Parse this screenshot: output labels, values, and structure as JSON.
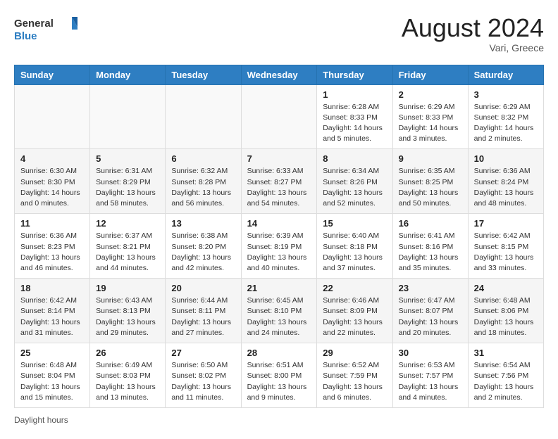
{
  "logo": {
    "line1": "General",
    "line2": "Blue"
  },
  "header": {
    "month_year": "August 2024",
    "location": "Vari, Greece"
  },
  "weekdays": [
    "Sunday",
    "Monday",
    "Tuesday",
    "Wednesday",
    "Thursday",
    "Friday",
    "Saturday"
  ],
  "weeks": [
    [
      {
        "day": "",
        "info": ""
      },
      {
        "day": "",
        "info": ""
      },
      {
        "day": "",
        "info": ""
      },
      {
        "day": "",
        "info": ""
      },
      {
        "day": "1",
        "info": "Sunrise: 6:28 AM\nSunset: 8:33 PM\nDaylight: 14 hours and 5 minutes."
      },
      {
        "day": "2",
        "info": "Sunrise: 6:29 AM\nSunset: 8:33 PM\nDaylight: 14 hours and 3 minutes."
      },
      {
        "day": "3",
        "info": "Sunrise: 6:29 AM\nSunset: 8:32 PM\nDaylight: 14 hours and 2 minutes."
      }
    ],
    [
      {
        "day": "4",
        "info": "Sunrise: 6:30 AM\nSunset: 8:30 PM\nDaylight: 14 hours and 0 minutes."
      },
      {
        "day": "5",
        "info": "Sunrise: 6:31 AM\nSunset: 8:29 PM\nDaylight: 13 hours and 58 minutes."
      },
      {
        "day": "6",
        "info": "Sunrise: 6:32 AM\nSunset: 8:28 PM\nDaylight: 13 hours and 56 minutes."
      },
      {
        "day": "7",
        "info": "Sunrise: 6:33 AM\nSunset: 8:27 PM\nDaylight: 13 hours and 54 minutes."
      },
      {
        "day": "8",
        "info": "Sunrise: 6:34 AM\nSunset: 8:26 PM\nDaylight: 13 hours and 52 minutes."
      },
      {
        "day": "9",
        "info": "Sunrise: 6:35 AM\nSunset: 8:25 PM\nDaylight: 13 hours and 50 minutes."
      },
      {
        "day": "10",
        "info": "Sunrise: 6:36 AM\nSunset: 8:24 PM\nDaylight: 13 hours and 48 minutes."
      }
    ],
    [
      {
        "day": "11",
        "info": "Sunrise: 6:36 AM\nSunset: 8:23 PM\nDaylight: 13 hours and 46 minutes."
      },
      {
        "day": "12",
        "info": "Sunrise: 6:37 AM\nSunset: 8:21 PM\nDaylight: 13 hours and 44 minutes."
      },
      {
        "day": "13",
        "info": "Sunrise: 6:38 AM\nSunset: 8:20 PM\nDaylight: 13 hours and 42 minutes."
      },
      {
        "day": "14",
        "info": "Sunrise: 6:39 AM\nSunset: 8:19 PM\nDaylight: 13 hours and 40 minutes."
      },
      {
        "day": "15",
        "info": "Sunrise: 6:40 AM\nSunset: 8:18 PM\nDaylight: 13 hours and 37 minutes."
      },
      {
        "day": "16",
        "info": "Sunrise: 6:41 AM\nSunset: 8:16 PM\nDaylight: 13 hours and 35 minutes."
      },
      {
        "day": "17",
        "info": "Sunrise: 6:42 AM\nSunset: 8:15 PM\nDaylight: 13 hours and 33 minutes."
      }
    ],
    [
      {
        "day": "18",
        "info": "Sunrise: 6:42 AM\nSunset: 8:14 PM\nDaylight: 13 hours and 31 minutes."
      },
      {
        "day": "19",
        "info": "Sunrise: 6:43 AM\nSunset: 8:13 PM\nDaylight: 13 hours and 29 minutes."
      },
      {
        "day": "20",
        "info": "Sunrise: 6:44 AM\nSunset: 8:11 PM\nDaylight: 13 hours and 27 minutes."
      },
      {
        "day": "21",
        "info": "Sunrise: 6:45 AM\nSunset: 8:10 PM\nDaylight: 13 hours and 24 minutes."
      },
      {
        "day": "22",
        "info": "Sunrise: 6:46 AM\nSunset: 8:09 PM\nDaylight: 13 hours and 22 minutes."
      },
      {
        "day": "23",
        "info": "Sunrise: 6:47 AM\nSunset: 8:07 PM\nDaylight: 13 hours and 20 minutes."
      },
      {
        "day": "24",
        "info": "Sunrise: 6:48 AM\nSunset: 8:06 PM\nDaylight: 13 hours and 18 minutes."
      }
    ],
    [
      {
        "day": "25",
        "info": "Sunrise: 6:48 AM\nSunset: 8:04 PM\nDaylight: 13 hours and 15 minutes."
      },
      {
        "day": "26",
        "info": "Sunrise: 6:49 AM\nSunset: 8:03 PM\nDaylight: 13 hours and 13 minutes."
      },
      {
        "day": "27",
        "info": "Sunrise: 6:50 AM\nSunset: 8:02 PM\nDaylight: 13 hours and 11 minutes."
      },
      {
        "day": "28",
        "info": "Sunrise: 6:51 AM\nSunset: 8:00 PM\nDaylight: 13 hours and 9 minutes."
      },
      {
        "day": "29",
        "info": "Sunrise: 6:52 AM\nSunset: 7:59 PM\nDaylight: 13 hours and 6 minutes."
      },
      {
        "day": "30",
        "info": "Sunrise: 6:53 AM\nSunset: 7:57 PM\nDaylight: 13 hours and 4 minutes."
      },
      {
        "day": "31",
        "info": "Sunrise: 6:54 AM\nSunset: 7:56 PM\nDaylight: 13 hours and 2 minutes."
      }
    ]
  ],
  "footer": {
    "daylight_label": "Daylight hours"
  }
}
